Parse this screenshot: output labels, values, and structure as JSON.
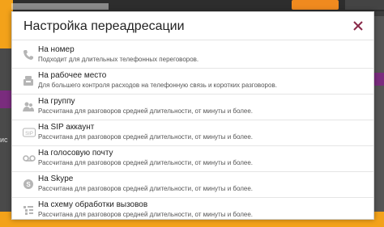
{
  "modal": {
    "title": "Настройка переадресации"
  },
  "background": {
    "left_label": "ис"
  },
  "items": [
    {
      "icon": "phone-icon",
      "title": "На номер",
      "desc": "Подходит для длительных телефонных переговоров."
    },
    {
      "icon": "desk-phone-icon",
      "title": "На рабочее место",
      "desc": "Для большего контроля расходов на телефонную связь и коротких разговоров."
    },
    {
      "icon": "group-icon",
      "title": "На группу",
      "desc": "Рассчитана для разговоров средней длительности, от минуты и более."
    },
    {
      "icon": "sip-icon",
      "title": "На SIP аккаунт",
      "desc": "Рассчитана для разговоров средней длительности, от минуты и более."
    },
    {
      "icon": "voicemail-icon",
      "title": "На голосовую почту",
      "desc": "Рассчитана для разговоров средней длительности, от минуты и более."
    },
    {
      "icon": "skype-icon",
      "title": "На Skype",
      "desc": "Рассчитана для разговоров средней длительности, от минуты и более."
    },
    {
      "icon": "call-flow-icon",
      "title": "На схему обработки вызовов",
      "desc": "Рассчитана для разговоров средней длительности, от минуты и более."
    }
  ]
}
